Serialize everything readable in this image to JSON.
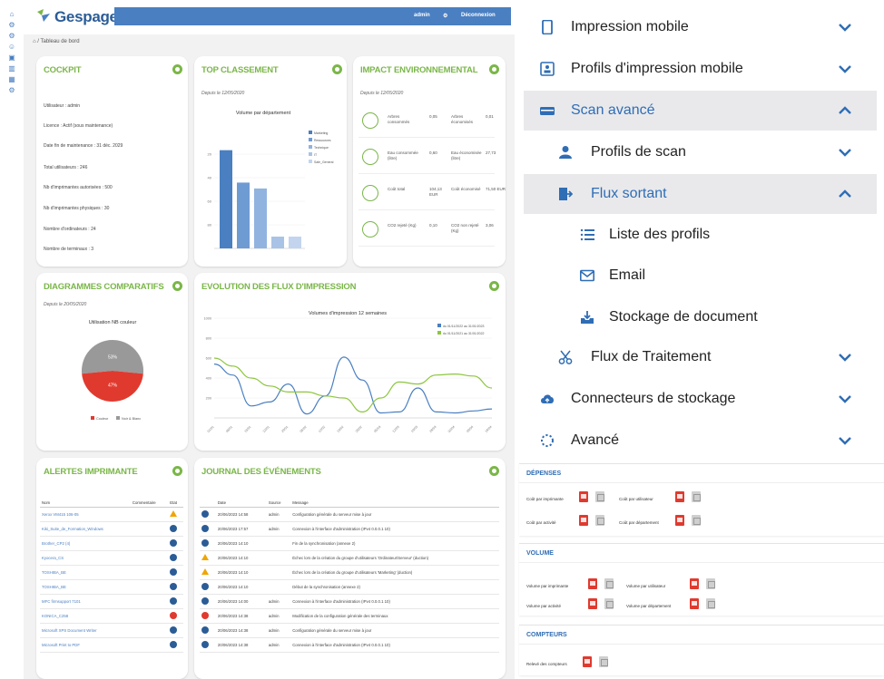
{
  "app": {
    "logo": "Gespage",
    "topbar": {
      "user": "admin",
      "deconnexion": "Déconnexion"
    },
    "breadcrumb": "Tableau de bord",
    "cockpit": {
      "title": "COCKPIT",
      "rows": [
        "Utilisateur : admin",
        "Licence : Actif (sous maintenance)",
        "Date fin de maintenance : 31 déc. 2029",
        "Total utilisateurs : 246",
        "Nb d'imprimantes autorisées : 500",
        "Nb d'imprimantes physiques : 30",
        "Nombre d'ordinateurs : 24",
        "Nombre de terminaux : 3"
      ]
    },
    "top_classement": {
      "title": "TOP CLASSEMENT",
      "date": "Depuis le 12/05/2020",
      "chart_title": "Volume par département",
      "legend": [
        "Marketing",
        "Ressources",
        "Technique",
        "IT",
        "Sale_General"
      ],
      "chart_data": {
        "type": "bar",
        "categories": [
          "Marketing",
          "Ressources",
          "Technique",
          "IT",
          "Sale_General"
        ],
        "values": [
          100,
          67,
          61,
          12,
          12
        ],
        "yticks": [
          "80",
          "60",
          "40",
          "20"
        ],
        "ylim": [
          0,
          120
        ]
      }
    },
    "impact": {
      "title": "IMPACT ENVIRONNEMENTAL",
      "date": "Depuis le 12/05/2020",
      "rows": [
        {
          "a": "Arbres consommés",
          "b": "0,05",
          "c": "Arbres économisés",
          "d": "0,01"
        },
        {
          "a": "Eau consommée (litre)",
          "b": "0,60",
          "c": "Eau économisée (litre)",
          "d": "27,73"
        },
        {
          "a": "Coût total",
          "b": "104,13 EUR",
          "c": "Coût économisé",
          "d": "71,50 EUR"
        },
        {
          "a": "CO2 rejeté (Kg)",
          "b": "0,10",
          "c": "CO2 non rejeté (Kg)",
          "d": "3,06"
        }
      ]
    },
    "diagrammes": {
      "title": "DIAGRAMMES COMPARATIFS",
      "date": "Depuis le 20/05/2020",
      "chart_title": "Utilisation NB couleur",
      "legend": [
        "Couleur",
        "Noir & Blanc"
      ],
      "chart_data": {
        "type": "pie",
        "labels": [
          "Couleur",
          "Noir & Blanc"
        ],
        "values": [
          53,
          47
        ],
        "slice_labels": [
          "53%",
          "47%"
        ],
        "colors": [
          "#999999",
          "#e03a2f"
        ]
      }
    },
    "evolution": {
      "title": "EVOLUTION DES FLUX D'IMPRESSION",
      "chart_title": "Volumes d'impression 12 semaines",
      "legend": [
        "du 01/11/2022 au 31/01/2023",
        "du 01/11/2021 au 31/01/2022"
      ],
      "chart_data": {
        "type": "line",
        "x": [
          "01/01",
          "08/01",
          "15/01",
          "22/01",
          "29/01",
          "05/02",
          "12/02",
          "19/02",
          "26/02",
          "05/03",
          "12/03",
          "19/03",
          "26/03",
          "02/04",
          "09/04",
          "16/04"
        ],
        "yticks": [
          "1000",
          "800",
          "600",
          "400",
          "200"
        ],
        "ylim": [
          0,
          1000
        ],
        "series": [
          {
            "name": "du 01/11/2022 au 31/01/2023",
            "color": "#4a7fc1",
            "values": [
              540,
              430,
              120,
              160,
              340,
              40,
              220,
              610,
              380,
              50,
              60,
              300,
              60,
              50,
              70,
              90
            ]
          },
          {
            "name": "du 01/11/2021 au 31/01/2022",
            "color": "#8dc63f",
            "values": [
              600,
              520,
              400,
              320,
              260,
              260,
              220,
              200,
              60,
              200,
              360,
              340,
              430,
              440,
              420,
              300
            ]
          }
        ]
      }
    },
    "alertes": {
      "title": "ALERTES IMPRIMANTE",
      "headers": [
        "Nom",
        "Commentaire",
        "Etat"
      ],
      "rows": [
        {
          "name": "Xerox VM415 106-05",
          "state": "warn"
        },
        {
          "name": "Kiki_Suite_de_Formation_Windows",
          "state": "info"
        },
        {
          "name": "Brother_CP2 (4)",
          "state": "info"
        },
        {
          "name": "Kyocera_CS",
          "state": "info"
        },
        {
          "name": "TOSHIBA_BE",
          "state": "info"
        },
        {
          "name": "TOSHIBA_BE",
          "state": "info"
        },
        {
          "name": "MFC firmsupport 7101",
          "state": "info"
        },
        {
          "name": "KONICA_C258",
          "state": "err"
        },
        {
          "name": "Microsoft XPS Document Writer",
          "state": "info"
        },
        {
          "name": "Microsoft Print to PDF",
          "state": "info"
        }
      ]
    },
    "journal": {
      "title": "JOURNAL DES ÉVÉNEMENTS",
      "headers": [
        "",
        "Date",
        "Source",
        "Message"
      ],
      "rows": [
        {
          "state": "info",
          "date": "20/06/2023 14:58",
          "src": "admin",
          "msg": "Configuration générale du serveur mise à jour"
        },
        {
          "state": "info",
          "date": "20/06/2023 17:57",
          "src": "admin",
          "msg": "Connexion à l'interface d'administration (IPv4 0.0.0.1 10)"
        },
        {
          "state": "info",
          "date": "20/06/2023 14:10",
          "src": "",
          "msg": "Fin de la synchronisation (annexe 2)"
        },
        {
          "state": "warn",
          "date": "20/06/2023 14:10",
          "src": "",
          "msg": "Échec lors de la création du groupe d'utilisateurs 'Ordinateur/Serveur' (duction)"
        },
        {
          "state": "warn",
          "date": "20/06/2023 14:10",
          "src": "",
          "msg": "Échec lors de la création du groupe d'utilisateurs 'Marketing' (duction)"
        },
        {
          "state": "info",
          "date": "20/06/2023 14:10",
          "src": "",
          "msg": "Début de la synchronisation (annexe 2)"
        },
        {
          "state": "info",
          "date": "20/06/2023 14:00",
          "src": "admin",
          "msg": "Connexion à l'interface d'administration (IPv4 0.0.0.1 10)"
        },
        {
          "state": "err",
          "date": "20/06/2023 14:38",
          "src": "admin",
          "msg": "Modification de la configuration générale des terminaux"
        },
        {
          "state": "info",
          "date": "20/06/2023 14:38",
          "src": "admin",
          "msg": "Configuration générale du serveur mise à jour"
        },
        {
          "state": "info",
          "date": "20/06/2023 14:38",
          "src": "admin",
          "msg": "Connexion à l'interface d'administration (IPv4 0.0.0.1 10)"
        }
      ]
    }
  },
  "menu": [
    {
      "label": "Impression mobile",
      "icon": "smartphone-icon",
      "level": 0,
      "expanded": false
    },
    {
      "label": "Profils d'impression mobile",
      "icon": "badge-icon",
      "level": 0,
      "expanded": false
    },
    {
      "label": "Scan avancé",
      "icon": "scanner-icon",
      "level": 0,
      "expanded": true,
      "highlight": true
    },
    {
      "label": "Profils de scan",
      "icon": "person-icon",
      "level": 1,
      "expanded": false
    },
    {
      "label": "Flux sortant",
      "icon": "exit-icon",
      "level": 1,
      "expanded": true,
      "highlight": true
    },
    {
      "label": "Liste des profils",
      "icon": "list-icon",
      "level": 2
    },
    {
      "label": "Email",
      "icon": "envelope-icon",
      "level": 2
    },
    {
      "label": "Stockage de document",
      "icon": "download-tray-icon",
      "level": 2
    },
    {
      "label": "Flux de Traitement",
      "icon": "scissors-icon",
      "level": 1,
      "expanded": false
    },
    {
      "label": "Connecteurs de stockage",
      "icon": "cloud-icon",
      "level": 0,
      "expanded": false
    },
    {
      "label": "Avancé",
      "icon": "dotted-circle-icon",
      "level": 0,
      "expanded": false
    }
  ],
  "reports": {
    "depenses": {
      "title": "DÉPENSES",
      "items": [
        "Coût par imprimante",
        "Coût par utilisateur",
        "Coût par activité",
        "Coût par département"
      ]
    },
    "volume": {
      "title": "VOLUME",
      "items": [
        "Volume par imprimante",
        "Volume par utilisateur",
        "Volume par activité",
        "Volume par département"
      ]
    },
    "compteurs": {
      "title": "COMPTEURS",
      "items": [
        "Relevé des compteurs"
      ]
    }
  },
  "colors": {
    "accent_green": "#7ab648",
    "brand_blue": "#4a7fc1",
    "menu_blue": "#2f6db5"
  }
}
